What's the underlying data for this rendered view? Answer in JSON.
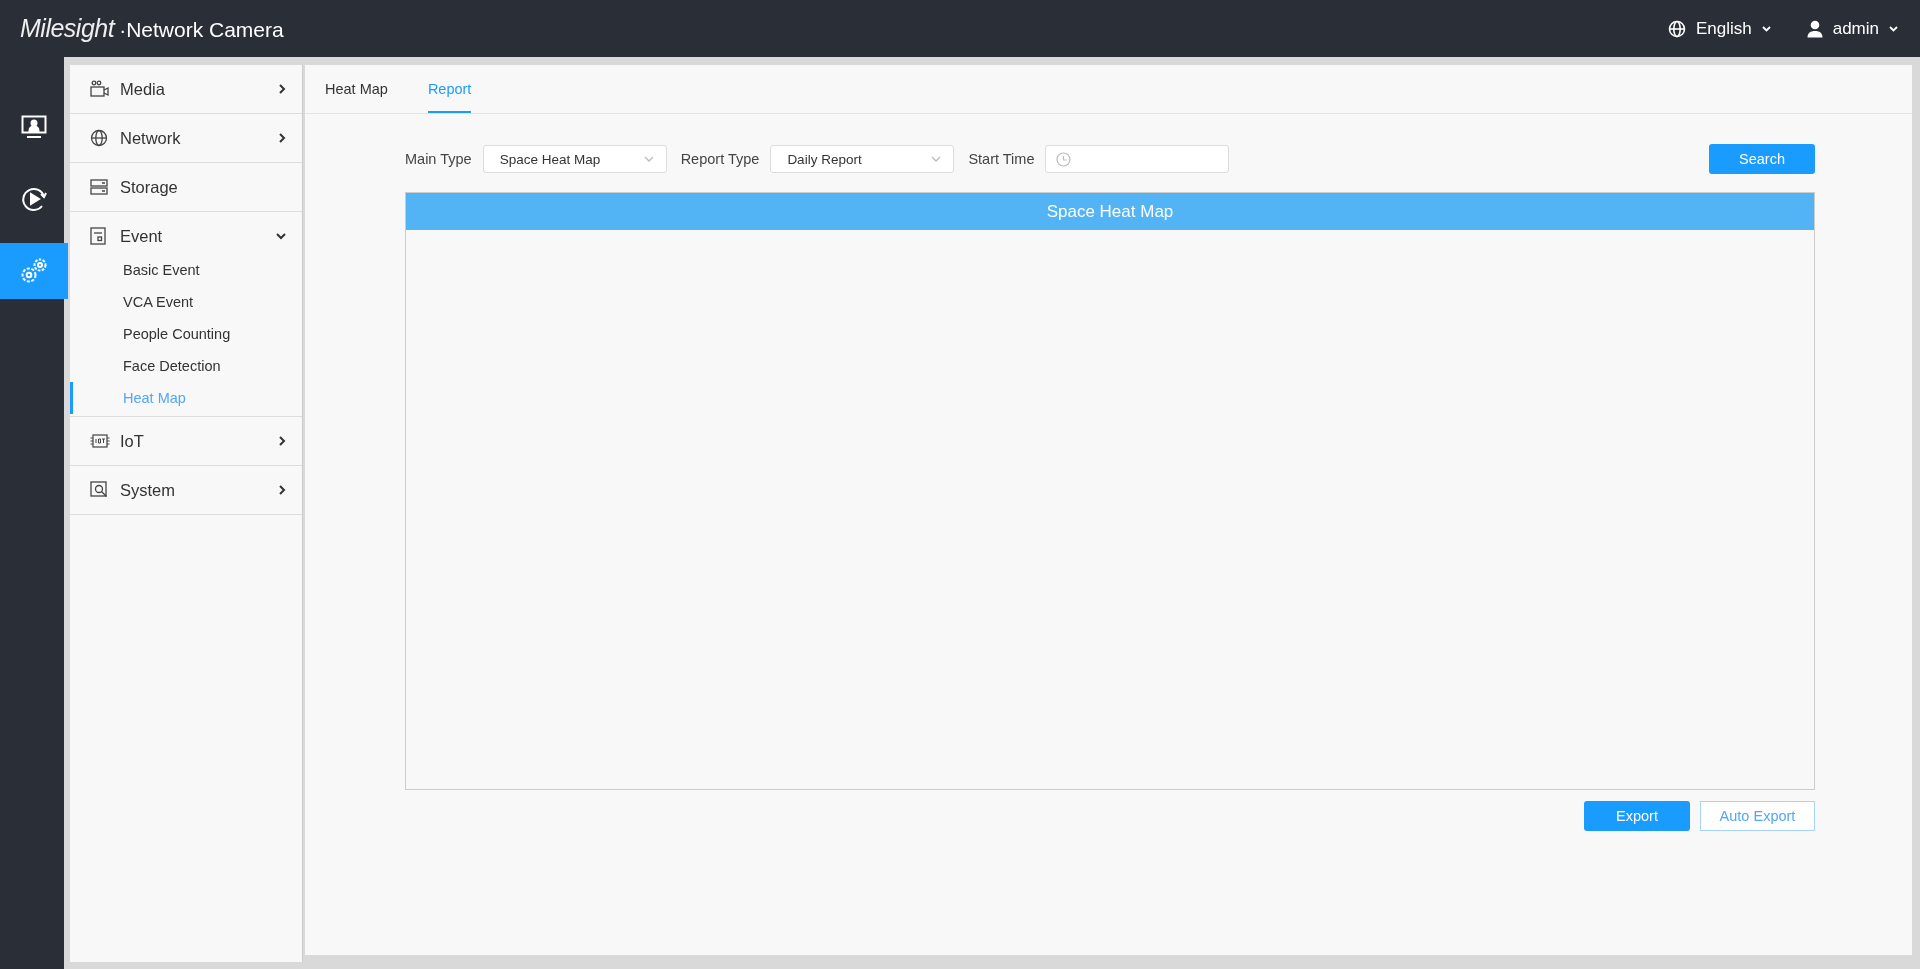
{
  "header": {
    "brand": "Milesight",
    "product": "·Network Camera",
    "language": "English",
    "user": "admin"
  },
  "rail": [
    {
      "selected": false
    },
    {
      "selected": false
    },
    {
      "selected": true
    }
  ],
  "menu": [
    {
      "kind": "group",
      "label": "Media",
      "expanded": false
    },
    {
      "kind": "group",
      "label": "Network",
      "expanded": false
    },
    {
      "kind": "page",
      "label": "Storage"
    },
    {
      "kind": "group",
      "label": "Event",
      "expanded": true,
      "children": [
        {
          "label": "Basic Event",
          "selected": false
        },
        {
          "label": "VCA Event",
          "selected": false
        },
        {
          "label": "People Counting",
          "selected": false
        },
        {
          "label": "Face Detection",
          "selected": false
        },
        {
          "label": "Heat Map",
          "selected": true
        }
      ]
    },
    {
      "kind": "group",
      "label": "IoT",
      "expanded": false
    },
    {
      "kind": "group",
      "label": "System",
      "expanded": false
    }
  ],
  "tabs": [
    {
      "label": "Heat Map",
      "selected": false
    },
    {
      "label": "Report",
      "selected": true
    }
  ],
  "filters": [
    {
      "kind": "select",
      "label": "Main Type",
      "value": "Space Heat Map"
    },
    {
      "kind": "select",
      "label": "Report Type",
      "value": "Daily Report"
    },
    {
      "kind": "time",
      "label": "Start Time"
    }
  ],
  "search_button": "Search",
  "chart_panel": {
    "title": "Space Heat Map"
  },
  "buttons": [
    {
      "kind": "primary",
      "label": "Export"
    },
    {
      "kind": "secondary",
      "label": "Auto Export"
    }
  ]
}
